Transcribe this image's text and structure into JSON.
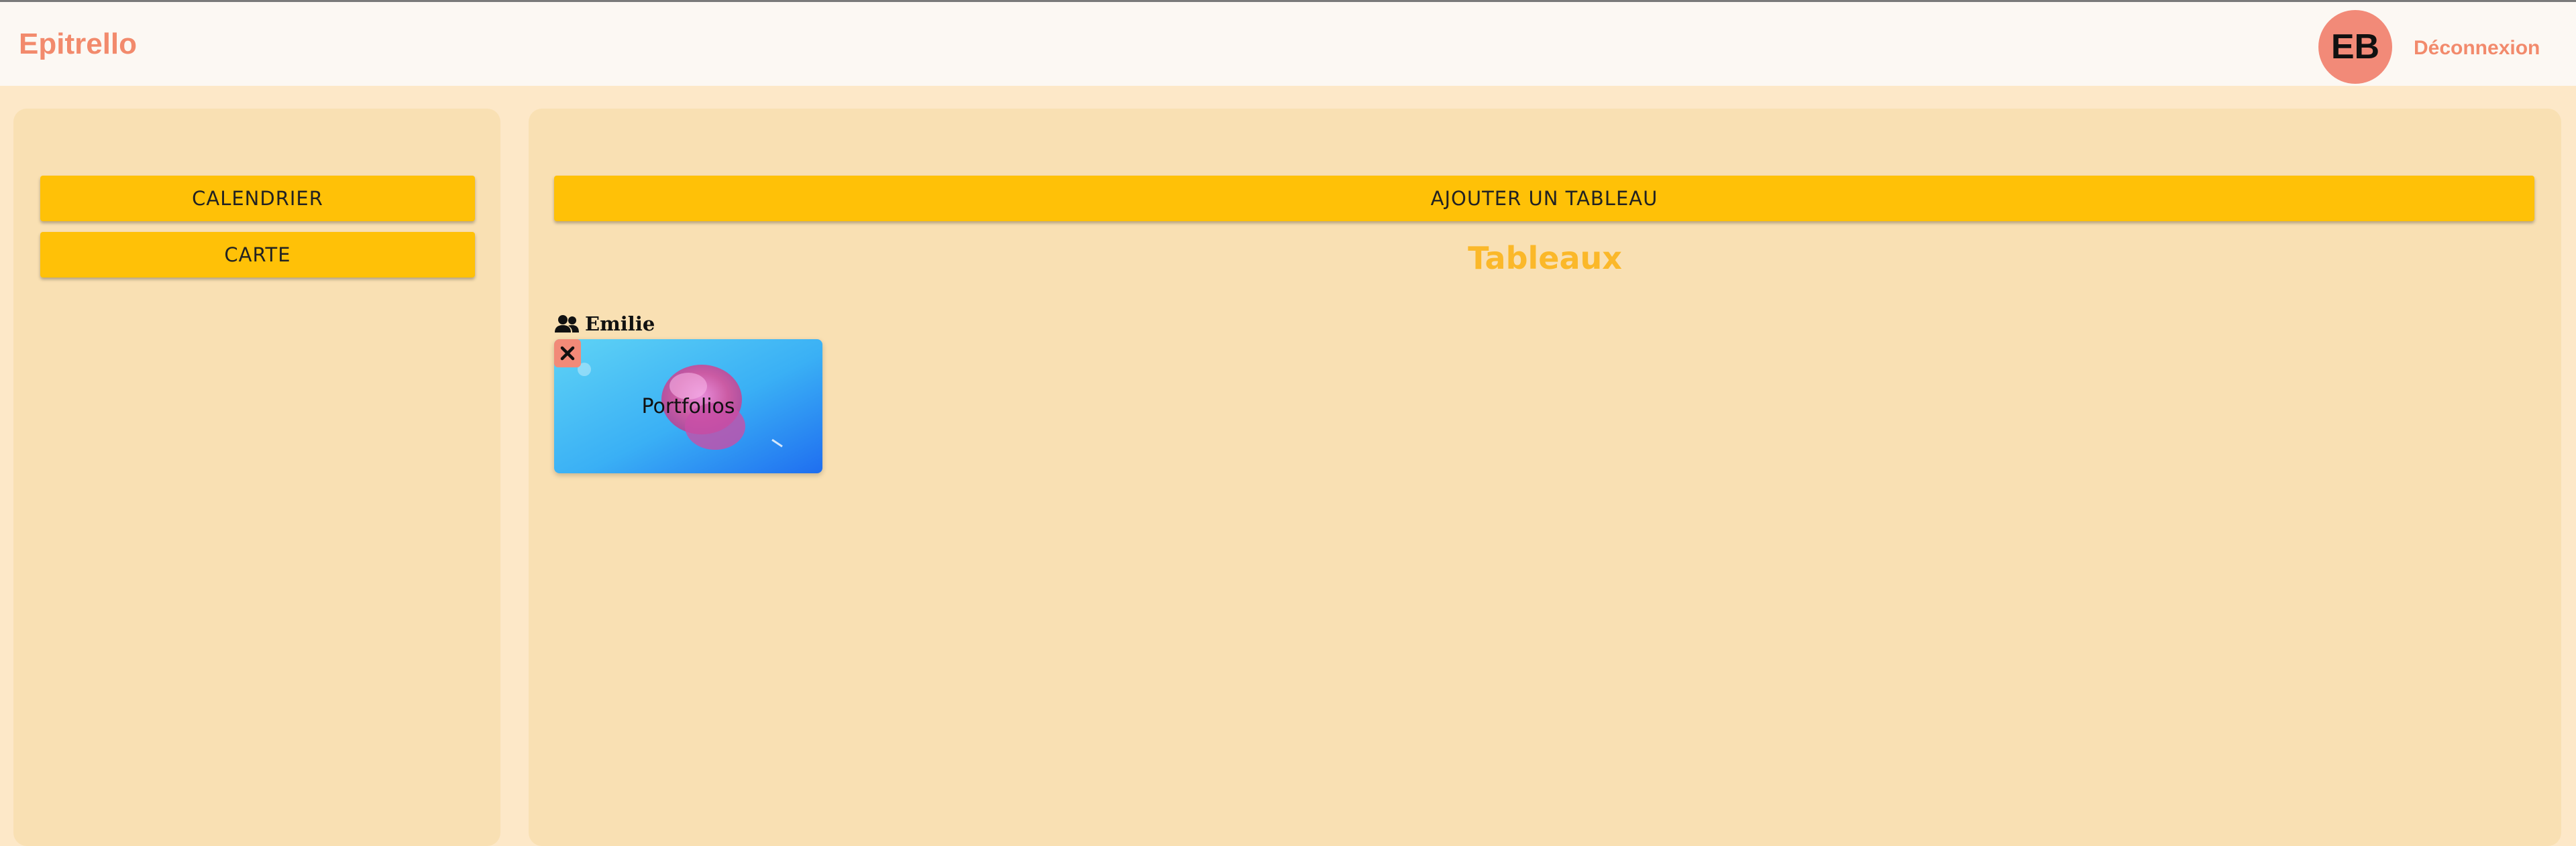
{
  "header": {
    "app_name": "Epitrello",
    "avatar_initials": "EB",
    "logout_label": "Déconnexion"
  },
  "sidebar": {
    "calendar_label": "CALENDRIER",
    "map_label": "CARTE"
  },
  "main": {
    "add_board_label": "AJOUTER UN TABLEAU",
    "section_title": "Tableaux",
    "owner_name": "Emilie",
    "boards": [
      {
        "title": "Portfolios",
        "icon": "close-icon"
      }
    ]
  },
  "colors": {
    "accent": "#ffc107",
    "brand": "#f28a6c",
    "panel": "#f9e0b3",
    "background": "#fde8c8"
  }
}
